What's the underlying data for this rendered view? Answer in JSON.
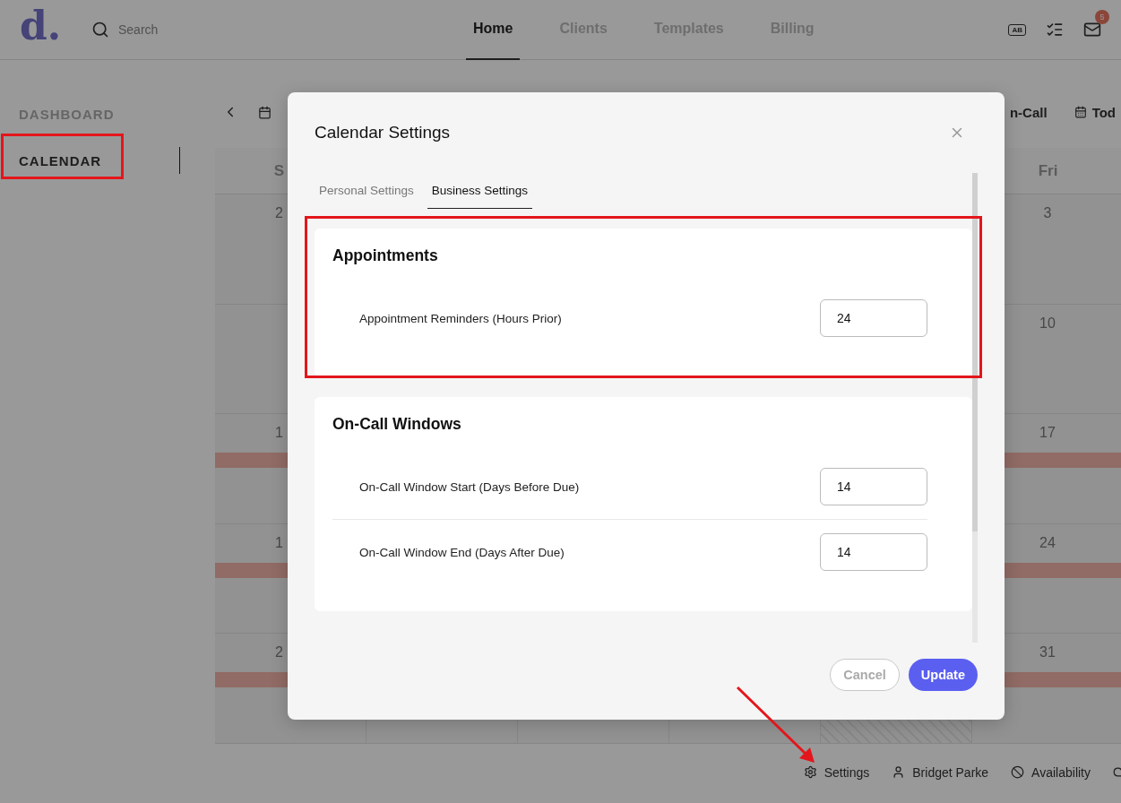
{
  "logo": "d.",
  "search": {
    "placeholder": "Search"
  },
  "nav_tabs": [
    {
      "label": "Home",
      "selected": true
    },
    {
      "label": "Clients",
      "selected": false
    },
    {
      "label": "Templates",
      "selected": false
    },
    {
      "label": "Billing",
      "selected": false
    }
  ],
  "profile_badge": "AB",
  "mail_badge": "5",
  "sidebar": {
    "items": [
      {
        "label": "DASHBOARD",
        "selected": false
      },
      {
        "label": "CALENDAR",
        "selected": true
      }
    ]
  },
  "calendar": {
    "on_call_button": "n-Call",
    "today_button": "Tod",
    "headers": {
      "sun": "S",
      "fri": "Fri"
    },
    "weeks": [
      {
        "kind": "plain",
        "sun": "2",
        "fri": "3"
      },
      {
        "kind": "plain",
        "fri": "10"
      },
      {
        "kind": "event",
        "sun": "1",
        "fri": "17"
      },
      {
        "kind": "event",
        "sun": "1",
        "fri": "24"
      },
      {
        "kind": "event_blocked",
        "sun": "2",
        "fri": "31"
      }
    ]
  },
  "footer_links": [
    {
      "kind": "settings",
      "label": "Settings"
    },
    {
      "kind": "user",
      "label": "Bridget Parke"
    },
    {
      "kind": "availability",
      "label": "Availability"
    }
  ],
  "modal": {
    "title": "Calendar Settings",
    "tabs": [
      {
        "label": "Personal Settings",
        "selected": false
      },
      {
        "label": "Business Settings",
        "selected": true
      }
    ],
    "sections": [
      {
        "title": "Appointments",
        "fields": [
          {
            "label": "Appointment Reminders (Hours Prior)",
            "value": "24"
          }
        ]
      },
      {
        "title": "On-Call Windows",
        "fields": [
          {
            "label": "On-Call Window Start (Days Before Due)",
            "value": "14"
          },
          {
            "label": "On-Call Window End (Days After Due)",
            "value": "14"
          }
        ]
      }
    ],
    "cancel": {
      "label": "Cancel",
      "disabled": true
    },
    "update": "Update"
  }
}
